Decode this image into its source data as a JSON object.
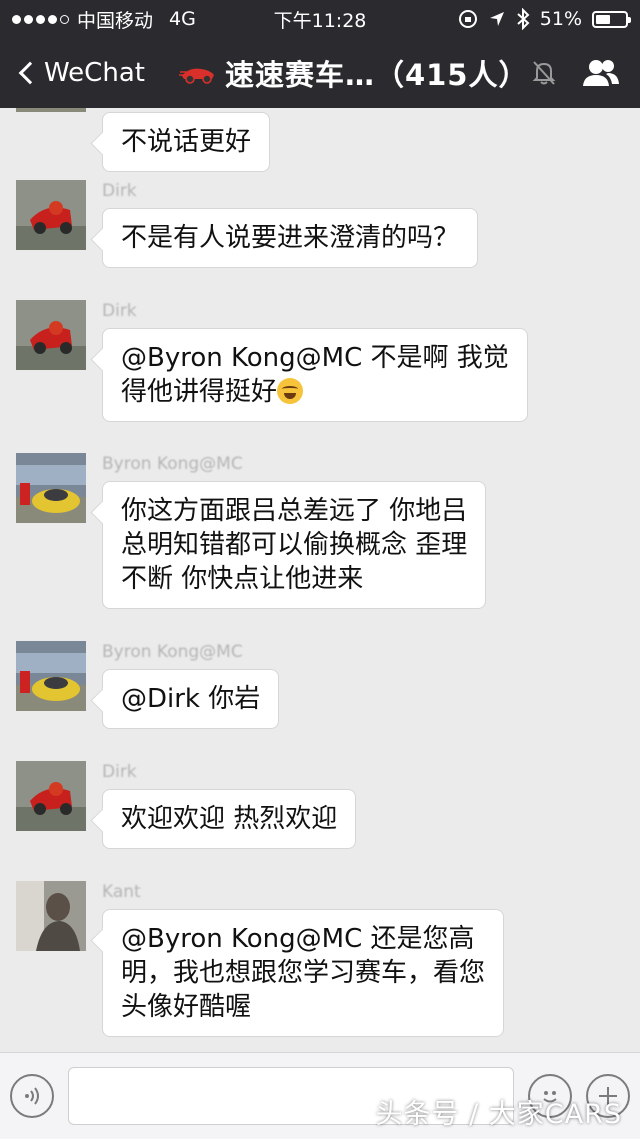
{
  "status_bar": {
    "carrier": "中国移动",
    "network": "4G",
    "time": "下午11:28",
    "battery_text": "51%",
    "battery_level": 0.51
  },
  "nav": {
    "back_label": "WeChat",
    "title": "速速赛车…（415人）"
  },
  "messages": [
    {
      "sender": "",
      "lines": [
        "不说话更好"
      ]
    },
    {
      "sender": "Dirk",
      "lines": [
        "不是有人说要进来澄清的吗？"
      ]
    },
    {
      "sender": "Dirk",
      "lines": [
        "@Byron Kong@MC 不是啊 我觉",
        "得他讲得挺好"
      ]
    },
    {
      "sender": "Byron Kong@MC",
      "lines": [
        "你这方面跟吕总差远了 你地吕",
        "总明知错都可以偷换概念 歪理",
        "不断 你快点让他进来"
      ]
    },
    {
      "sender": "Byron Kong@MC",
      "lines": [
        "@Dirk 你岩"
      ]
    },
    {
      "sender": "Dirk",
      "lines": [
        "欢迎欢迎 热烈欢迎"
      ]
    },
    {
      "sender": "Kant",
      "lines": [
        "@Byron Kong@MC 还是您高",
        "明，我也想跟您学习赛车，看您",
        "头像好酷喔"
      ]
    }
  ],
  "icons": {
    "voice": "voice-icon",
    "emoji": "emoji-icon",
    "plus": "plus-icon",
    "mute": "mute-bell-icon",
    "members": "group-members-icon"
  },
  "watermark": "头条号 / 大家CARS",
  "colors": {
    "bar_bg": "#2b2b2f",
    "chat_bg": "#ebebeb",
    "bubble_bg": "#ffffff"
  }
}
